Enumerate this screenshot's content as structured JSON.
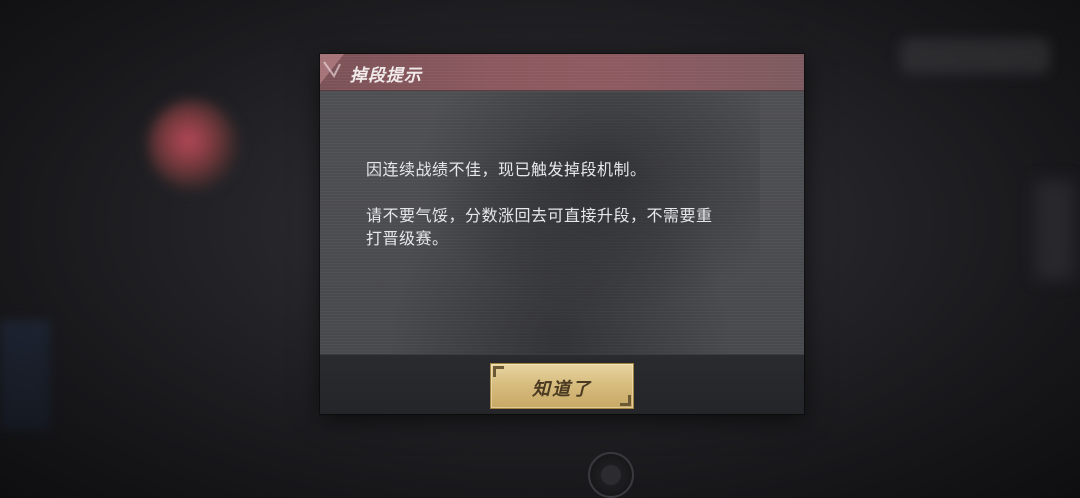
{
  "dialog": {
    "title": "掉段提示",
    "body_lines": [
      "因连续战绩不佳，现已触发掉段机制。",
      "请不要气馁，分数涨回去可直接升段，不需要重",
      "打晋级赛。"
    ],
    "confirm_label": "知道了"
  },
  "colors": {
    "header_accent": "#8a585e",
    "button_gold": "#d7bd7f",
    "button_text": "#4a3a22",
    "body_text": "#e6e7ea"
  },
  "icons": {
    "header_corner": "chevron-corner-icon",
    "bottom_circle": "circle-button-icon"
  }
}
